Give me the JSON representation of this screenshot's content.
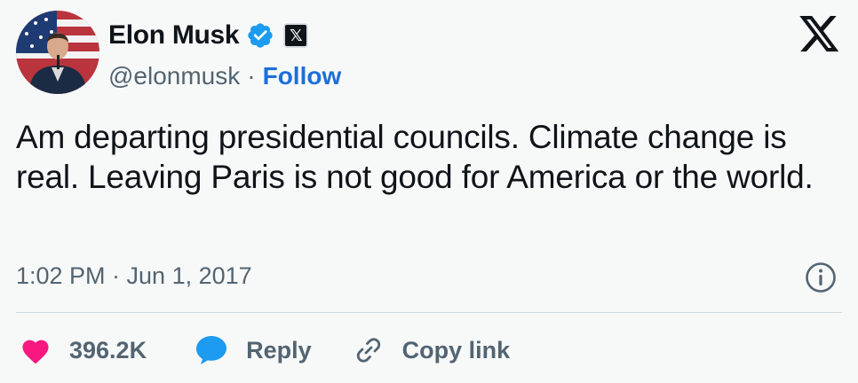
{
  "author": {
    "display_name": "Elon Musk",
    "handle": "@elonmusk",
    "separator": "·",
    "follow_label": "Follow",
    "x_badge_glyph": "𝕏"
  },
  "tweet": {
    "text": "Am departing presidential councils. Climate change is real. Leaving Paris is not good for America or the world.",
    "timestamp": "1:02 PM · Jun 1, 2017"
  },
  "actions": {
    "like_count": "396.2K",
    "reply_label": "Reply",
    "copy_label": "Copy link"
  },
  "icons": {
    "verified": "verified-badge-icon",
    "x_logo": "x-logo-icon",
    "info": "info-icon",
    "heart": "heart-icon",
    "reply": "reply-bubble-icon",
    "link": "link-icon"
  },
  "colors": {
    "background": "#f7f9f9",
    "accent_blue": "#1d6fd8",
    "verified_blue": "#1d9bf0",
    "heart_pink": "#f91880",
    "secondary_text": "#536471"
  }
}
